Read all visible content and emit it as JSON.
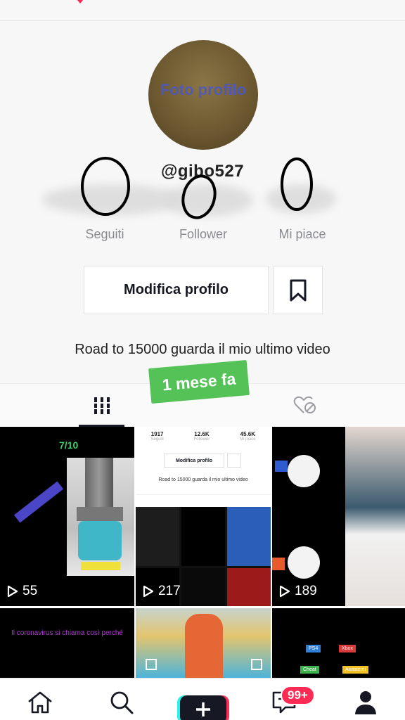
{
  "profile": {
    "avatar_text": "Foto profilo",
    "username": "@gibo527",
    "stats": {
      "following_label": "Seguiti",
      "followers_label": "Follower",
      "likes_label": "Mi piace"
    },
    "edit_label": "Modifica profilo",
    "bio": "Road to 15000 guarda il mio ultimo video"
  },
  "toast": "1 mese fa",
  "tabs": {
    "videos_icon": "grid-icon",
    "liked_icon": "heart-lock-icon"
  },
  "videos": [
    {
      "views": "55",
      "overlay": "7/10"
    },
    {
      "views": "217"
    },
    {
      "views": "189"
    },
    {
      "overlay": "Il coronavirus si chiama così perché"
    },
    {},
    {
      "tags": [
        "PS4",
        "Xbox",
        "Cheat",
        "Aiutatemi"
      ]
    }
  ],
  "thumbnail_profile": {
    "stats": [
      {
        "value": "1917",
        "label": "Seguiti"
      },
      {
        "value": "12.6K",
        "label": "Follower"
      },
      {
        "value": "45.6K",
        "label": "Mi piace"
      }
    ],
    "edit_label": "Modifica profilo",
    "bio": "Road to 15000 guarda il mio ultimo video"
  },
  "bottom_nav": {
    "home_icon": "home-icon",
    "discover_icon": "search-icon",
    "create_icon": "plus-icon",
    "inbox_icon": "inbox-icon",
    "inbox_badge": "99+",
    "profile_icon": "profile-icon"
  },
  "colors": {
    "accent": "#fe2c55",
    "toast": "#55c257",
    "teal": "#25f4ee"
  }
}
